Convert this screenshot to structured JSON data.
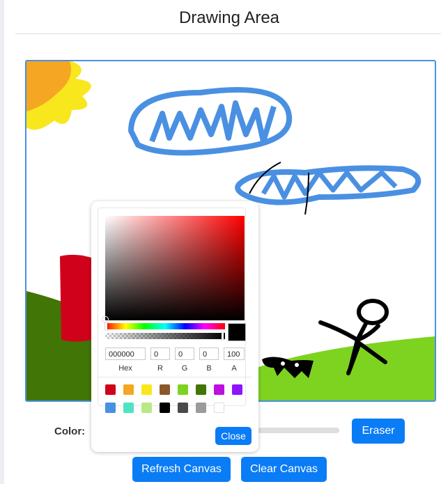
{
  "header": {
    "title": "Drawing Area"
  },
  "controls": {
    "color_label": "Color:",
    "eraser_label": "Eraser",
    "refresh_label": "Refresh Canvas",
    "clear_label": "Clear Canvas"
  },
  "color_picker": {
    "hex": "000000",
    "r": "0",
    "g": "0",
    "b": "0",
    "a": "100",
    "labels": {
      "hex": "Hex",
      "r": "R",
      "g": "G",
      "b": "B",
      "a": "A"
    },
    "close_label": "Close",
    "swatches": [
      "#d0021b",
      "#f5a623",
      "#f8e71c",
      "#8b572a",
      "#7ed321",
      "#417505",
      "#bd10e0",
      "#9013fe",
      "#4a90e2",
      "#50e3c2",
      "#b8e986",
      "#000000",
      "#4a4a4a",
      "#9b9b9b",
      "#ffffff"
    ]
  },
  "colors": {
    "accent": "#0a7cf5",
    "canvas_border": "#4a90e2"
  }
}
